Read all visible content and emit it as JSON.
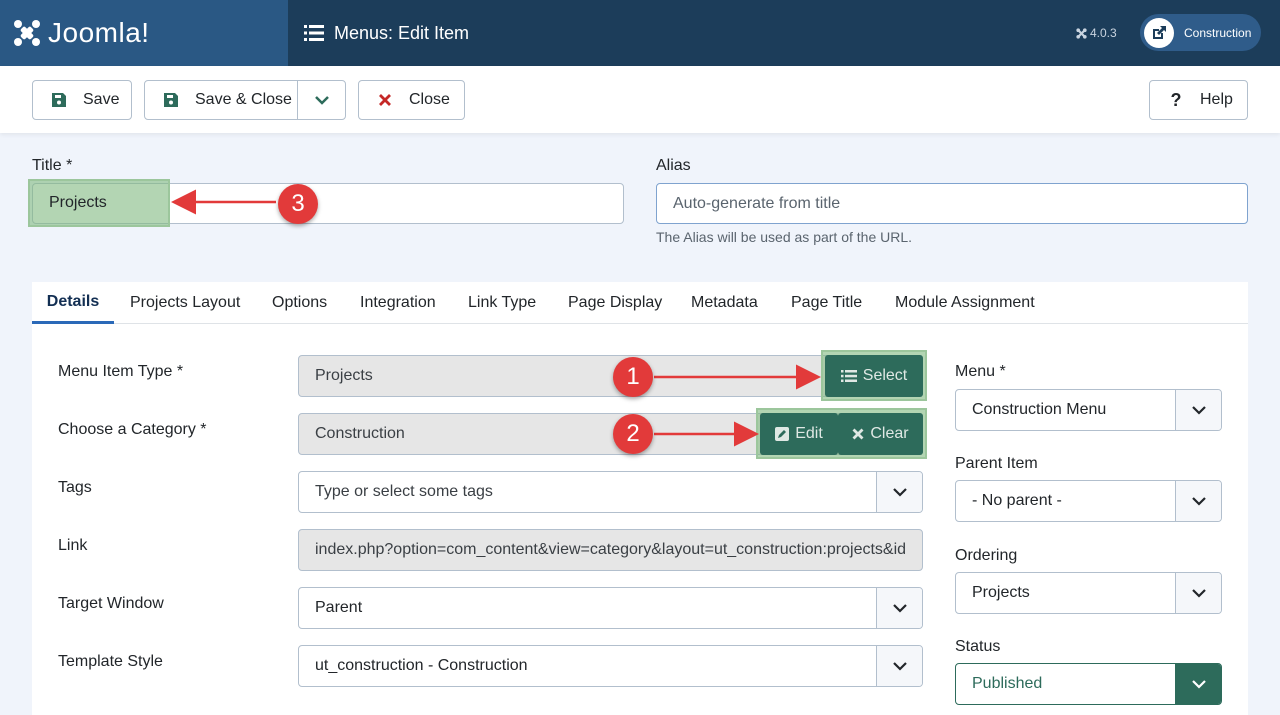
{
  "header": {
    "brand": "Joomla!",
    "page_title": "Menus: Edit Item",
    "version": "4.0.3",
    "site_button": "Construction"
  },
  "toolbar": {
    "save": "Save",
    "save_close": "Save & Close",
    "close": "Close",
    "help": "Help"
  },
  "form": {
    "title_label": "Title *",
    "title_value": "Projects",
    "alias_label": "Alias",
    "alias_placeholder": "Auto-generate from title",
    "alias_hint": "The Alias will be used as part of the URL."
  },
  "tabs": [
    "Details",
    "Projects Layout",
    "Options",
    "Integration",
    "Link Type",
    "Page Display",
    "Metadata",
    "Page Title",
    "Module Assignment"
  ],
  "details": {
    "menu_item_type_label": "Menu Item Type *",
    "menu_item_type_value": "Projects",
    "select_button": "Select",
    "category_label": "Choose a Category *",
    "category_value": "Construction",
    "edit_button": "Edit",
    "clear_button": "Clear",
    "tags_label": "Tags",
    "tags_placeholder": "Type or select some tags",
    "link_label": "Link",
    "link_value": "index.php?option=com_content&view=category&layout=ut_construction:projects&id",
    "target_label": "Target Window",
    "target_value": "Parent",
    "template_label": "Template Style",
    "template_value": "ut_construction - Construction"
  },
  "sidebar": {
    "menu_label": "Menu *",
    "menu_value": "Construction Menu",
    "parent_label": "Parent Item",
    "parent_value": "- No parent -",
    "ordering_label": "Ordering",
    "ordering_value": "Projects",
    "status_label": "Status",
    "status_value": "Published"
  },
  "callouts": [
    "1",
    "2",
    "3"
  ],
  "colors": {
    "header_bg": "#1c3d5a",
    "logo_bg": "#2a5884",
    "action_green": "#2d6b5b",
    "callout_red": "#e23a3a",
    "tab_accent": "#2a69b8"
  }
}
